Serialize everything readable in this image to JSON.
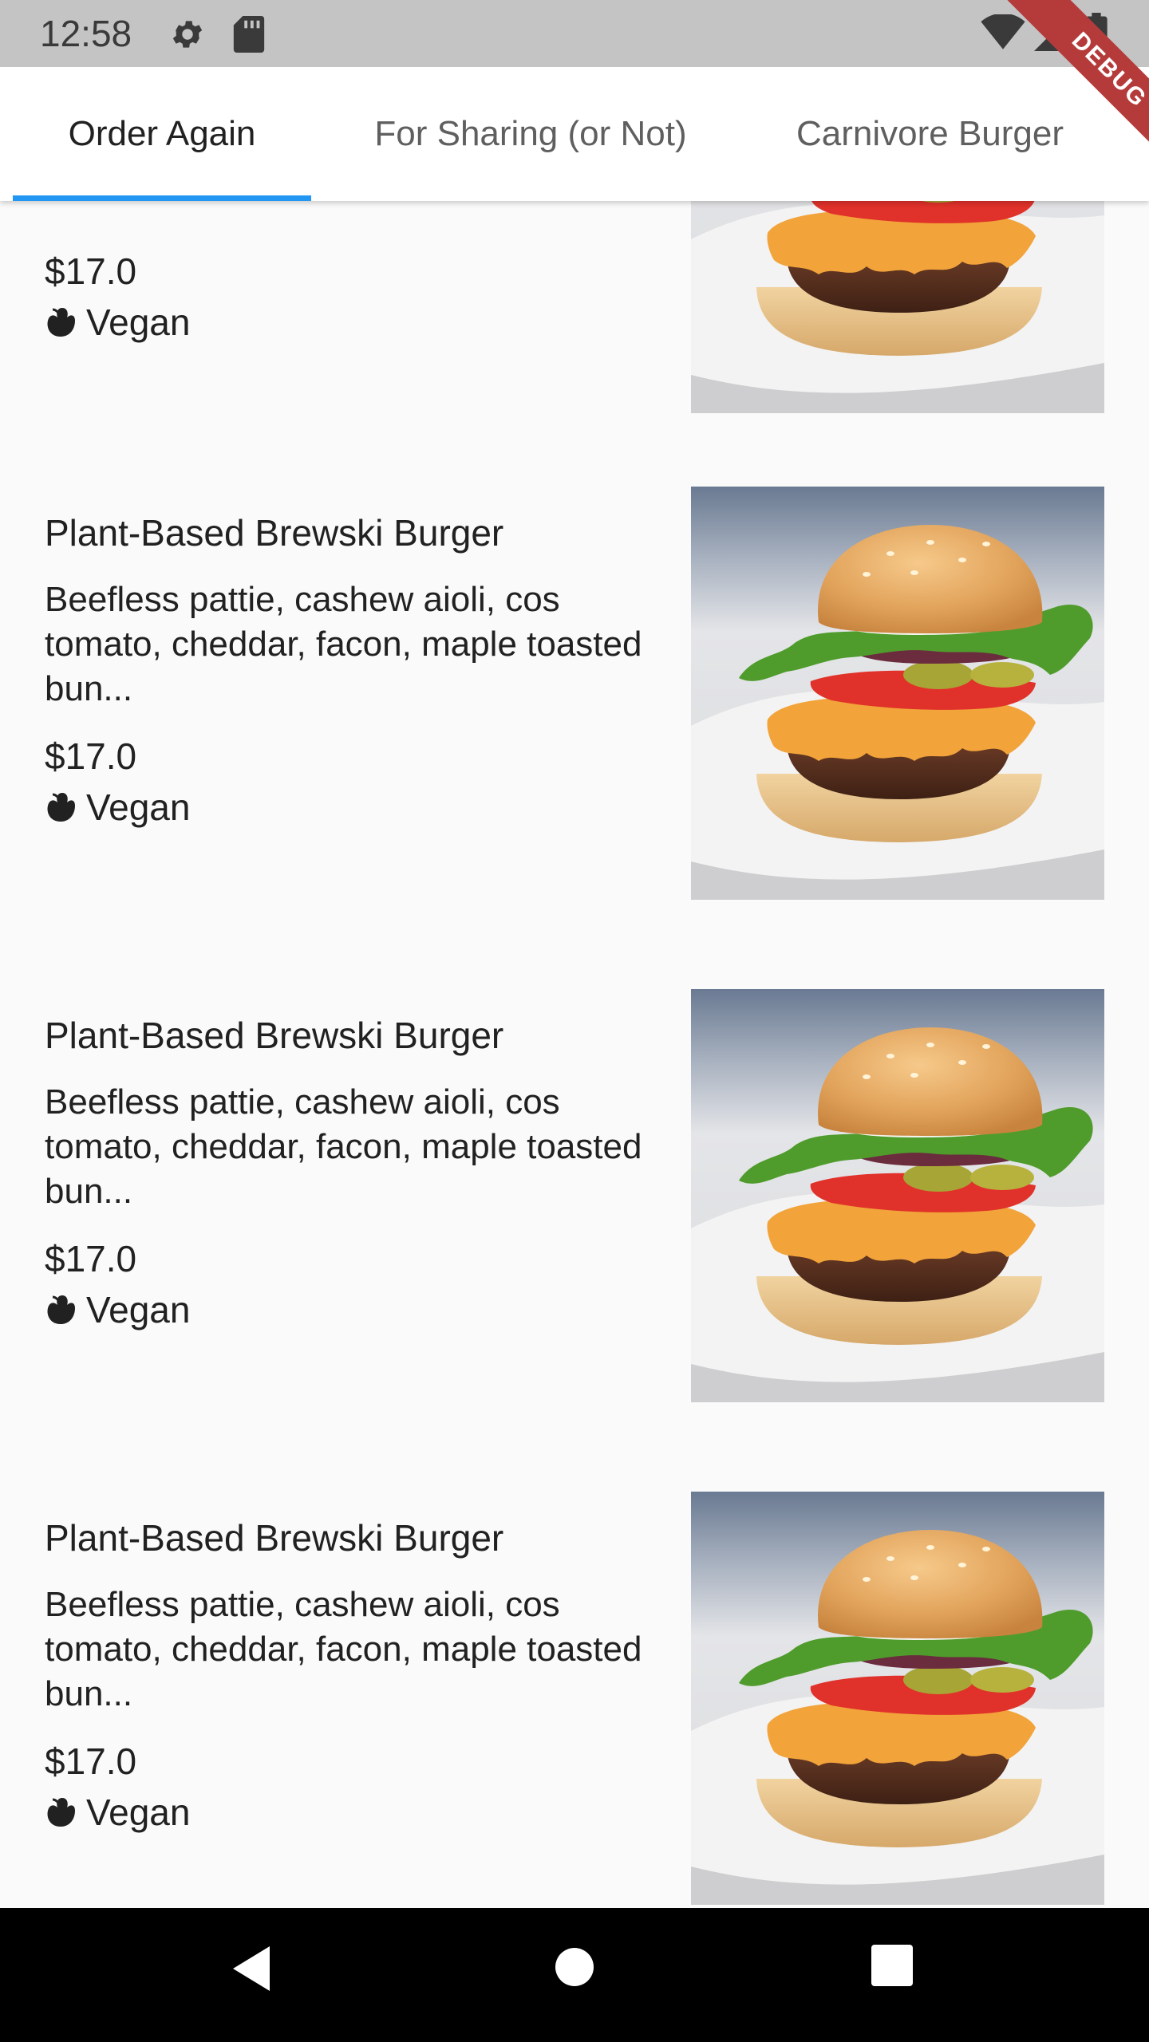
{
  "status_bar": {
    "time": "12:58",
    "icons": [
      "gear-icon",
      "sd-card-icon",
      "wifi-icon",
      "signal-icon",
      "battery-icon"
    ]
  },
  "debug_banner": "DEBUG",
  "tabs": [
    {
      "label": "Order Again",
      "selected": true
    },
    {
      "label": "For Sharing (or Not)",
      "selected": false
    },
    {
      "label": "Carnivore Burger",
      "selected": false
    }
  ],
  "accent_color": "#2196f3",
  "items": [
    {
      "title": "",
      "description": "",
      "price": "$17.0",
      "tag": "Vegan",
      "tag_icon": "plant-icon",
      "image": "burger-photo"
    },
    {
      "title": "Plant-Based Brewski Burger",
      "description": "Beefless pattie, cashew aioli, cos tomato, cheddar, facon, maple toasted bun...",
      "price": "$17.0",
      "tag": "Vegan",
      "tag_icon": "plant-icon",
      "image": "burger-photo"
    },
    {
      "title": "Plant-Based Brewski Burger",
      "description": "Beefless pattie, cashew aioli, cos tomato, cheddar, facon, maple toasted bun...",
      "price": "$17.0",
      "tag": "Vegan",
      "tag_icon": "plant-icon",
      "image": "burger-photo"
    },
    {
      "title": "Plant-Based Brewski Burger",
      "description": "Beefless pattie, cashew aioli, cos tomato, cheddar, facon, maple toasted bun...",
      "price": "$17.0",
      "tag": "Vegan",
      "tag_icon": "plant-icon",
      "image": "burger-photo"
    }
  ],
  "nav_bar": {
    "buttons": [
      "back-icon",
      "home-icon",
      "recents-icon"
    ]
  }
}
